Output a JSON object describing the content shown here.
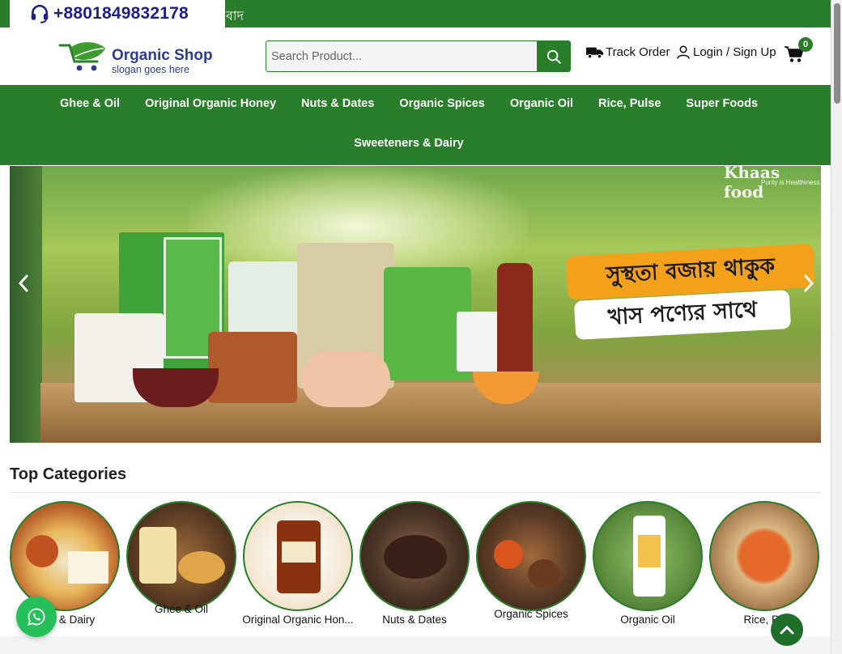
{
  "topbar": {
    "phone": "+8801849832178",
    "marquee": "বাদ",
    "icon": "headset-icon"
  },
  "header": {
    "logo": {
      "brand": "Organic Shop",
      "slogan": "slogan goes here"
    },
    "search": {
      "placeholder": "Search Product...",
      "icon": "search-icon"
    },
    "track_order": "Track Order",
    "login": "Login / Sign Up",
    "cart_count": "0"
  },
  "nav": {
    "row1": [
      "Ghee & Oil",
      "Original Organic Honey",
      "Nuts & Dates",
      "Organic Spices",
      "Organic Oil",
      "Rice, Pulse",
      "Super Foods"
    ],
    "row2": [
      "Sweeteners & Dairy"
    ]
  },
  "banner": {
    "watermark": "Khaas food",
    "watermark_sub": "Purity is Healthiness",
    "headline_line1": "সুস্থতা বজায় থাকুক",
    "headline_line2": "খাস পণ্যের সাথে"
  },
  "categories": {
    "title": "Top Categories",
    "items": [
      {
        "label": "Sweeteners & Dairy",
        "shown": "ners & Dairy"
      },
      {
        "label": "Ghee & Oil",
        "shown": "Ghee & Oil"
      },
      {
        "label": "Original Organic Honey",
        "shown": "Original Organic Hon..."
      },
      {
        "label": "Nuts & Dates",
        "shown": "Nuts & Dates"
      },
      {
        "label": "Organic Spices",
        "shown": "Organic Spices"
      },
      {
        "label": "Organic Oil",
        "shown": "Organic Oil"
      },
      {
        "label": "Rice, Pulse",
        "shown": "Rice, Pu"
      }
    ]
  },
  "colors": {
    "primary_green": "#2a7d2a",
    "brand_blue": "#2c3d8f",
    "banner_orange": "#f3a11b",
    "whatsapp_green": "#25c05a"
  }
}
